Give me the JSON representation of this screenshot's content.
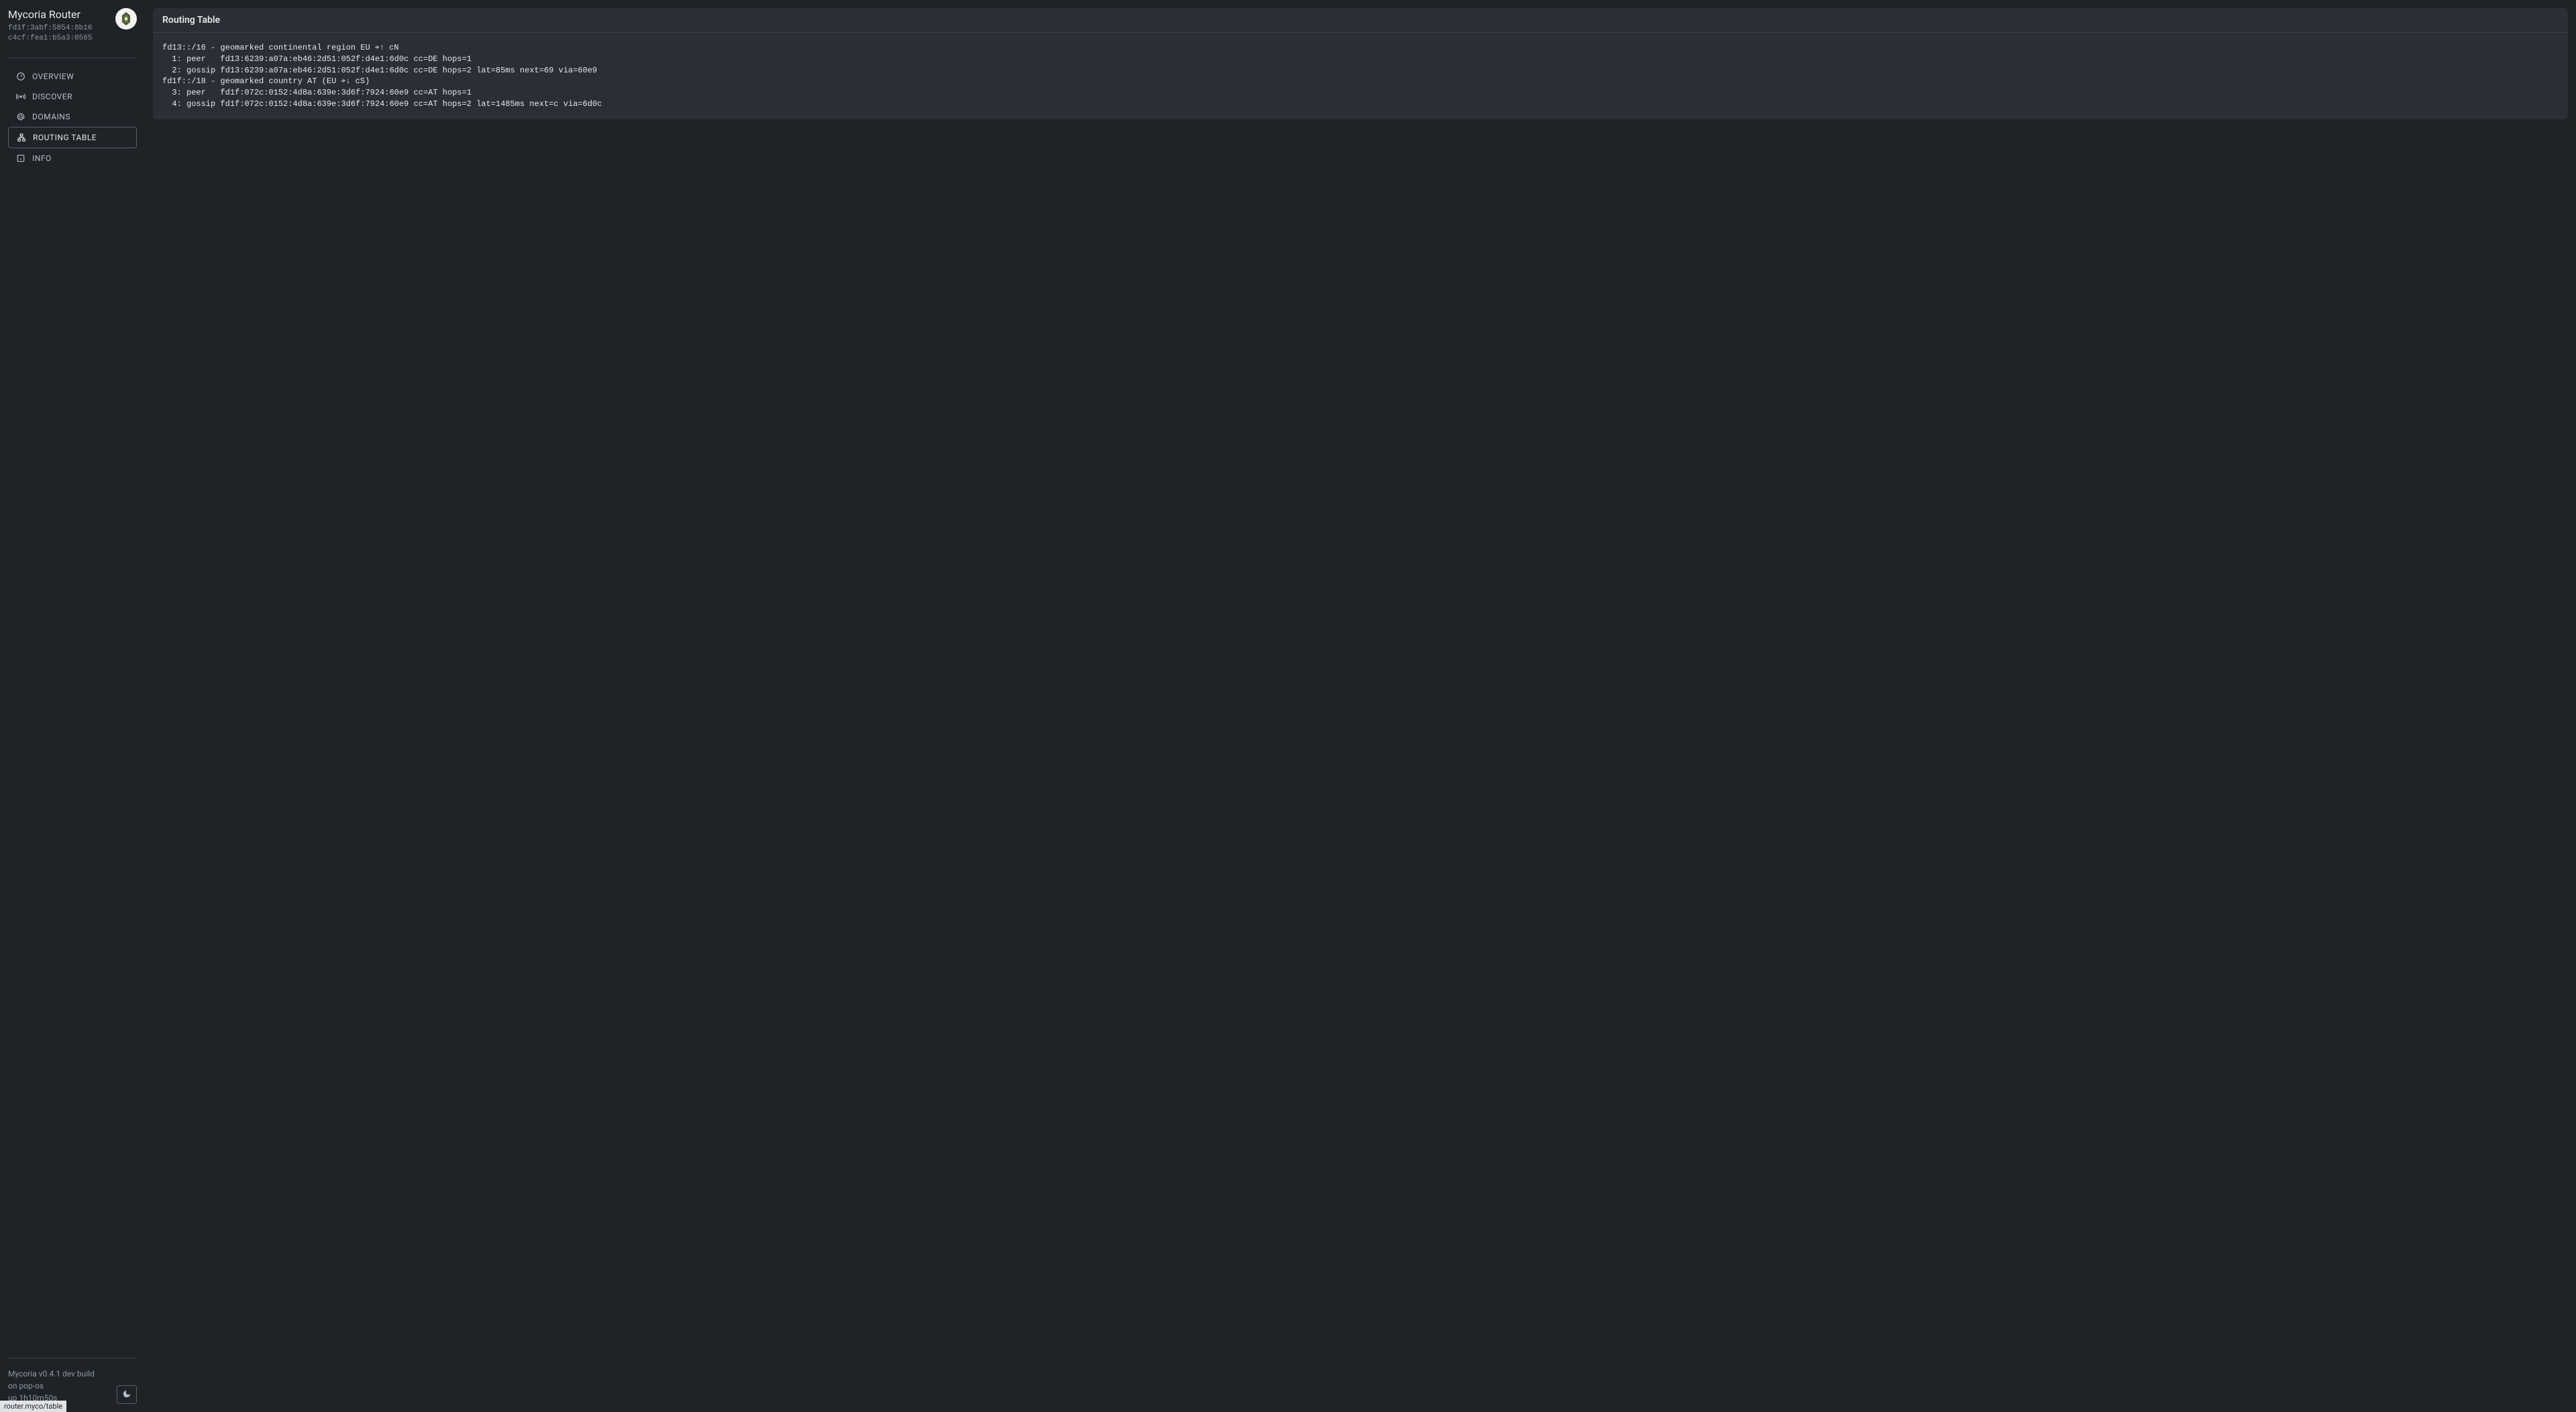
{
  "sidebar": {
    "title": "Mycoria Router",
    "router_id_line1": "fd1f:3abf:5854:8b16",
    "router_id_line2": "c4cf:fea1:b5a3:0565",
    "nav": {
      "overview": "OVERVIEW",
      "discover": "DISCOVER",
      "domains": "DOMAINS",
      "routing_table": "ROUTING TABLE",
      "info": "INFO"
    },
    "footer": {
      "version": "Mycoria v0.4.1 dev build",
      "host": "on pop-os",
      "uptime": "up 1h10m50s"
    }
  },
  "main": {
    "panel_title": "Routing Table",
    "routing_lines": [
      "fd13::/16 - geomarked continental region EU ⌖↑ cN",
      "  1: peer   fd13:6239:a07a:eb46:2d51:052f:d4e1:6d0c cc=DE hops=1",
      "  2: gossip fd13:6239:a07a:eb46:2d51:052f:d4e1:6d0c cc=DE hops=2 lat=85ms next=69 via=60e9",
      "fd1f::/18 - geomarked country AT (EU ⌖↓ cS)",
      "  3: peer   fd1f:072c:0152:4d8a:639e:3d6f:7924:60e9 cc=AT hops=1",
      "  4: gossip fd1f:072c:0152:4d8a:639e:3d6f:7924:60e9 cc=AT hops=2 lat=1485ms next=c via=6d0c"
    ]
  },
  "status_bar": "router.myco/table"
}
